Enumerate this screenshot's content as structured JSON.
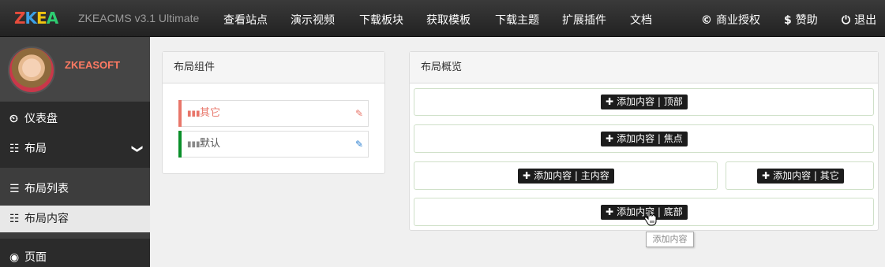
{
  "topnav": {
    "logo": [
      "Z",
      "K",
      "E",
      "A"
    ],
    "brand": "ZKEACMS v3.1 Ultimate",
    "links": [
      "查看站点",
      "演示视频",
      "下载板块",
      "获取模板",
      "下载主题",
      "扩展插件",
      "文档"
    ],
    "right": [
      {
        "icon": "©",
        "label": "商业授权"
      },
      {
        "icon": "$",
        "label": "赞助"
      },
      {
        "icon": "⏻",
        "label": "退出"
      }
    ]
  },
  "sidebar": {
    "user": "ZKEASOFT",
    "items": [
      {
        "icon": "⏲",
        "label": "仪表盘"
      },
      {
        "icon": "☷",
        "label": "布局",
        "chevron": "❯"
      },
      {
        "icon": "☰",
        "label": "布局列表"
      },
      {
        "icon": "☷",
        "label": "布局内容"
      },
      {
        "icon": "◉",
        "label": "页面"
      }
    ]
  },
  "layout_components": {
    "title": "布局组件",
    "widgets": [
      {
        "label": "其它",
        "color": "#e8766a"
      },
      {
        "label": "默认",
        "color": "#0a8f2a"
      }
    ]
  },
  "layout_overview": {
    "title": "布局概览",
    "buttons": {
      "top": "添加内容 | 顶部",
      "focus": "添加内容 | 焦点",
      "main": "添加内容 | 主内容",
      "other": "添加内容 | 其它",
      "bottom": "添加内容 | 底部"
    },
    "tooltip": "添加内容"
  },
  "colors": {
    "accent_red": "#ff7a63",
    "zone_border": "#cfe0c8"
  }
}
